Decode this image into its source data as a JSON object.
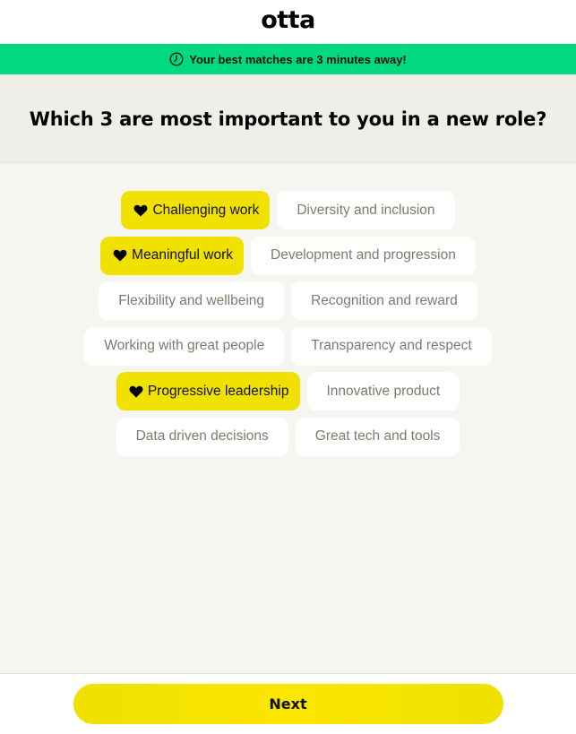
{
  "header": {
    "logo": "otta"
  },
  "banner": {
    "icon": "clock-icon",
    "text": "Your best matches are 3 minutes away!",
    "background": "#00d97e"
  },
  "question": {
    "title": "Which 3 are most important to you in a new role?"
  },
  "options": {
    "selected_color": "#f0e100",
    "rows": [
      [
        {
          "label": "Challenging work",
          "selected": true
        },
        {
          "label": "Diversity and inclusion",
          "selected": false
        }
      ],
      [
        {
          "label": "Meaningful work",
          "selected": true
        },
        {
          "label": "Development and progression",
          "selected": false
        }
      ],
      [
        {
          "label": "Flexibility and wellbeing",
          "selected": false
        },
        {
          "label": "Recognition and reward",
          "selected": false
        }
      ],
      [
        {
          "label": "Working with great people",
          "selected": false
        },
        {
          "label": "Transparency and respect",
          "selected": false
        }
      ],
      [
        {
          "label": "Progressive leadership",
          "selected": true
        },
        {
          "label": "Innovative product",
          "selected": false
        }
      ],
      [
        {
          "label": "Data driven decisions",
          "selected": false
        },
        {
          "label": "Great tech and tools",
          "selected": false
        }
      ]
    ]
  },
  "footer": {
    "next_label": "Next"
  }
}
